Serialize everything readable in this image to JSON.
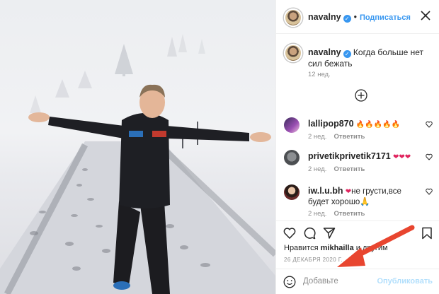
{
  "header": {
    "username": "navalny",
    "verified_mark": "✓",
    "separator": "•",
    "follow_label": "Подписаться",
    "more_icon": "more-icon"
  },
  "caption": {
    "username": "navalny",
    "text": "Когда больше нет сил бежать",
    "age": "12 нед."
  },
  "load_more_icon": "plus-circle-icon",
  "comments": [
    {
      "username": "lallipop870",
      "text": "🔥🔥🔥🔥🔥",
      "age": "2 нед.",
      "reply": "Ответить"
    },
    {
      "username": "privetikprivetik7171",
      "text": "❤❤❤",
      "age": "2 нед.",
      "reply": "Ответить"
    },
    {
      "username": "iw.l.u.bh",
      "text": "не грусти,все будет хорошо🙏",
      "prefix": "❤",
      "age": "2 нед.",
      "reply": "Ответить"
    }
  ],
  "likes": {
    "prefix": "Нравится",
    "user": "mikhailla",
    "suffix": "и другим"
  },
  "date": "26 ДЕКАБРЯ 2020 Г.",
  "add_comment": {
    "placeholder": "Добавьте",
    "post_label": "Опубликовать"
  },
  "colors": {
    "accent": "#3897f0",
    "arrow": "#e8452f"
  }
}
